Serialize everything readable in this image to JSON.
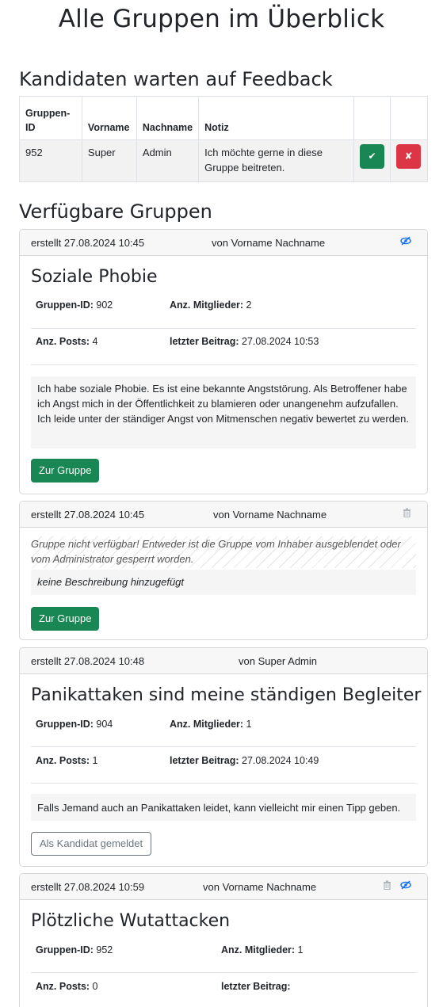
{
  "page": {
    "title": "Alle Gruppen im Überblick"
  },
  "candidates": {
    "heading": "Kandidaten warten auf Feedback",
    "columns": [
      "Gruppen-ID",
      "Vorname",
      "Nachname",
      "Notiz"
    ],
    "rows": [
      {
        "group_id": "952",
        "firstname": "Super",
        "lastname": "Admin",
        "note": "Ich möchte gerne in diese Gruppe beitreten.",
        "accept_icon": "✔",
        "reject_icon": "✘"
      }
    ]
  },
  "available": {
    "heading": "Verfügbare Gruppen"
  },
  "labels": {
    "group_id": "Gruppen-ID:",
    "members": "Anz. Mitglieder:",
    "posts": "Anz. Posts:",
    "last_post": "letzter Beitrag:",
    "go_button": "Zur Gruppe",
    "candidate_button": "Als Kandidat gemeldet"
  },
  "colors": {
    "success": "#198754",
    "danger": "#dc3545",
    "primary": "#0d6efd"
  },
  "icons": {
    "eye": "eye-slash-icon",
    "trash": "trash-icon"
  },
  "groups": [
    {
      "created": "erstellt 27.08.2024 10:45",
      "by": "von Vorname Nachname",
      "title": "Soziale Phobie",
      "group_id": "902",
      "members": "2",
      "posts": "4",
      "last_post": "27.08.2024 10:53",
      "description": "Ich habe soziale Phobie. Es ist eine bekannte Angststörung. Als Betroffener habe ich Angst mich in der Öffentlichkeit zu blamieren oder unangenehm aufzufallen. Ich leide unter der ständiger Angst von Mitmenschen negativ bewertet zu werden."
    },
    {
      "created": "erstellt 27.08.2024 10:45",
      "by": "von Vorname Nachname",
      "unavailable": "Gruppe nicht verfügbar! Entweder ist die Gruppe vom Inhaber ausgeblendet oder vom Administrator gesperrt worden.",
      "description": "keine Beschreibung hinzugefügt"
    },
    {
      "created": "erstellt 27.08.2024 10:48",
      "by": "von Super Admin",
      "title": "Panikattaken sind meine ständigen Begleiter",
      "group_id": "904",
      "members": "1",
      "posts": "1",
      "last_post": "27.08.2024 10:49",
      "description": "Falls Jemand auch an Panikattaken leidet, kann vielleicht mir einen Tipp geben."
    },
    {
      "created": "erstellt 27.08.2024 10:59",
      "by": "von Vorname Nachname",
      "title": "Plötzliche Wutattacken",
      "group_id": "952",
      "members": "1",
      "posts": "0",
      "last_post": ""
    }
  ]
}
